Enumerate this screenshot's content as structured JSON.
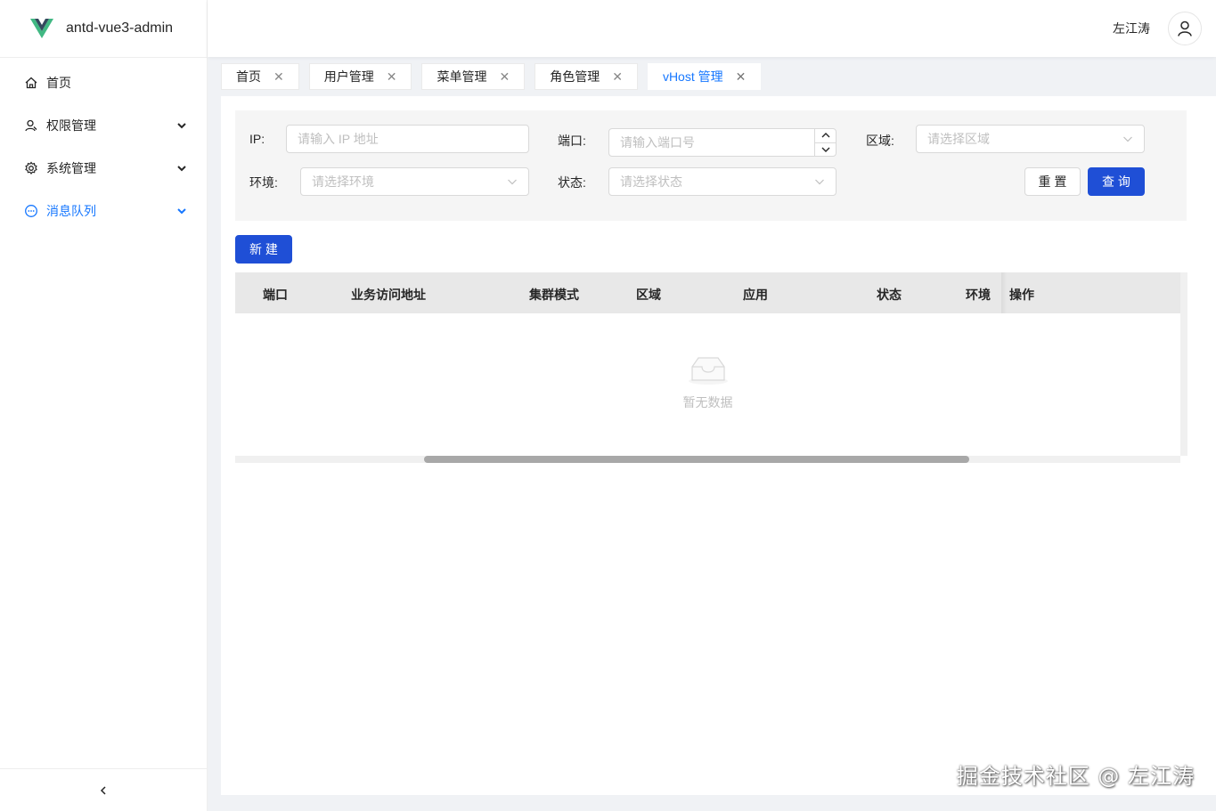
{
  "app": {
    "title": "antd-vue3-admin"
  },
  "sidebar": {
    "items": [
      {
        "label": "首页",
        "icon": "home-icon"
      },
      {
        "label": "权限管理",
        "icon": "user-icon"
      },
      {
        "label": "系统管理",
        "icon": "gear-icon"
      },
      {
        "label": "消息队列",
        "icon": "message-icon",
        "active": true
      }
    ]
  },
  "header": {
    "user_name": "左江涛"
  },
  "tabs": [
    {
      "label": "首页"
    },
    {
      "label": "用户管理"
    },
    {
      "label": "菜单管理"
    },
    {
      "label": "角色管理"
    },
    {
      "label": "vHost 管理",
      "active": true
    }
  ],
  "search": {
    "ip_label": "IP:",
    "ip_placeholder": "请输入 IP 地址",
    "port_label": "端口:",
    "port_placeholder": "请输入端口号",
    "region_label": "区域:",
    "region_placeholder": "请选择区域",
    "env_label": "环境:",
    "env_placeholder": "请选择环境",
    "status_label": "状态:",
    "status_placeholder": "请选择状态",
    "reset_label": "重 置",
    "query_label": "查 询"
  },
  "actions": {
    "new_label": "新 建"
  },
  "table": {
    "columns": [
      "端口",
      "业务访问地址",
      "集群模式",
      "区域",
      "应用",
      "状态",
      "环境",
      "操作"
    ],
    "empty_text": "暂无数据"
  },
  "watermark": "掘金技术社区 @ 左江涛",
  "colors": {
    "primary": "#1f4fd6",
    "link": "#1677ff"
  }
}
